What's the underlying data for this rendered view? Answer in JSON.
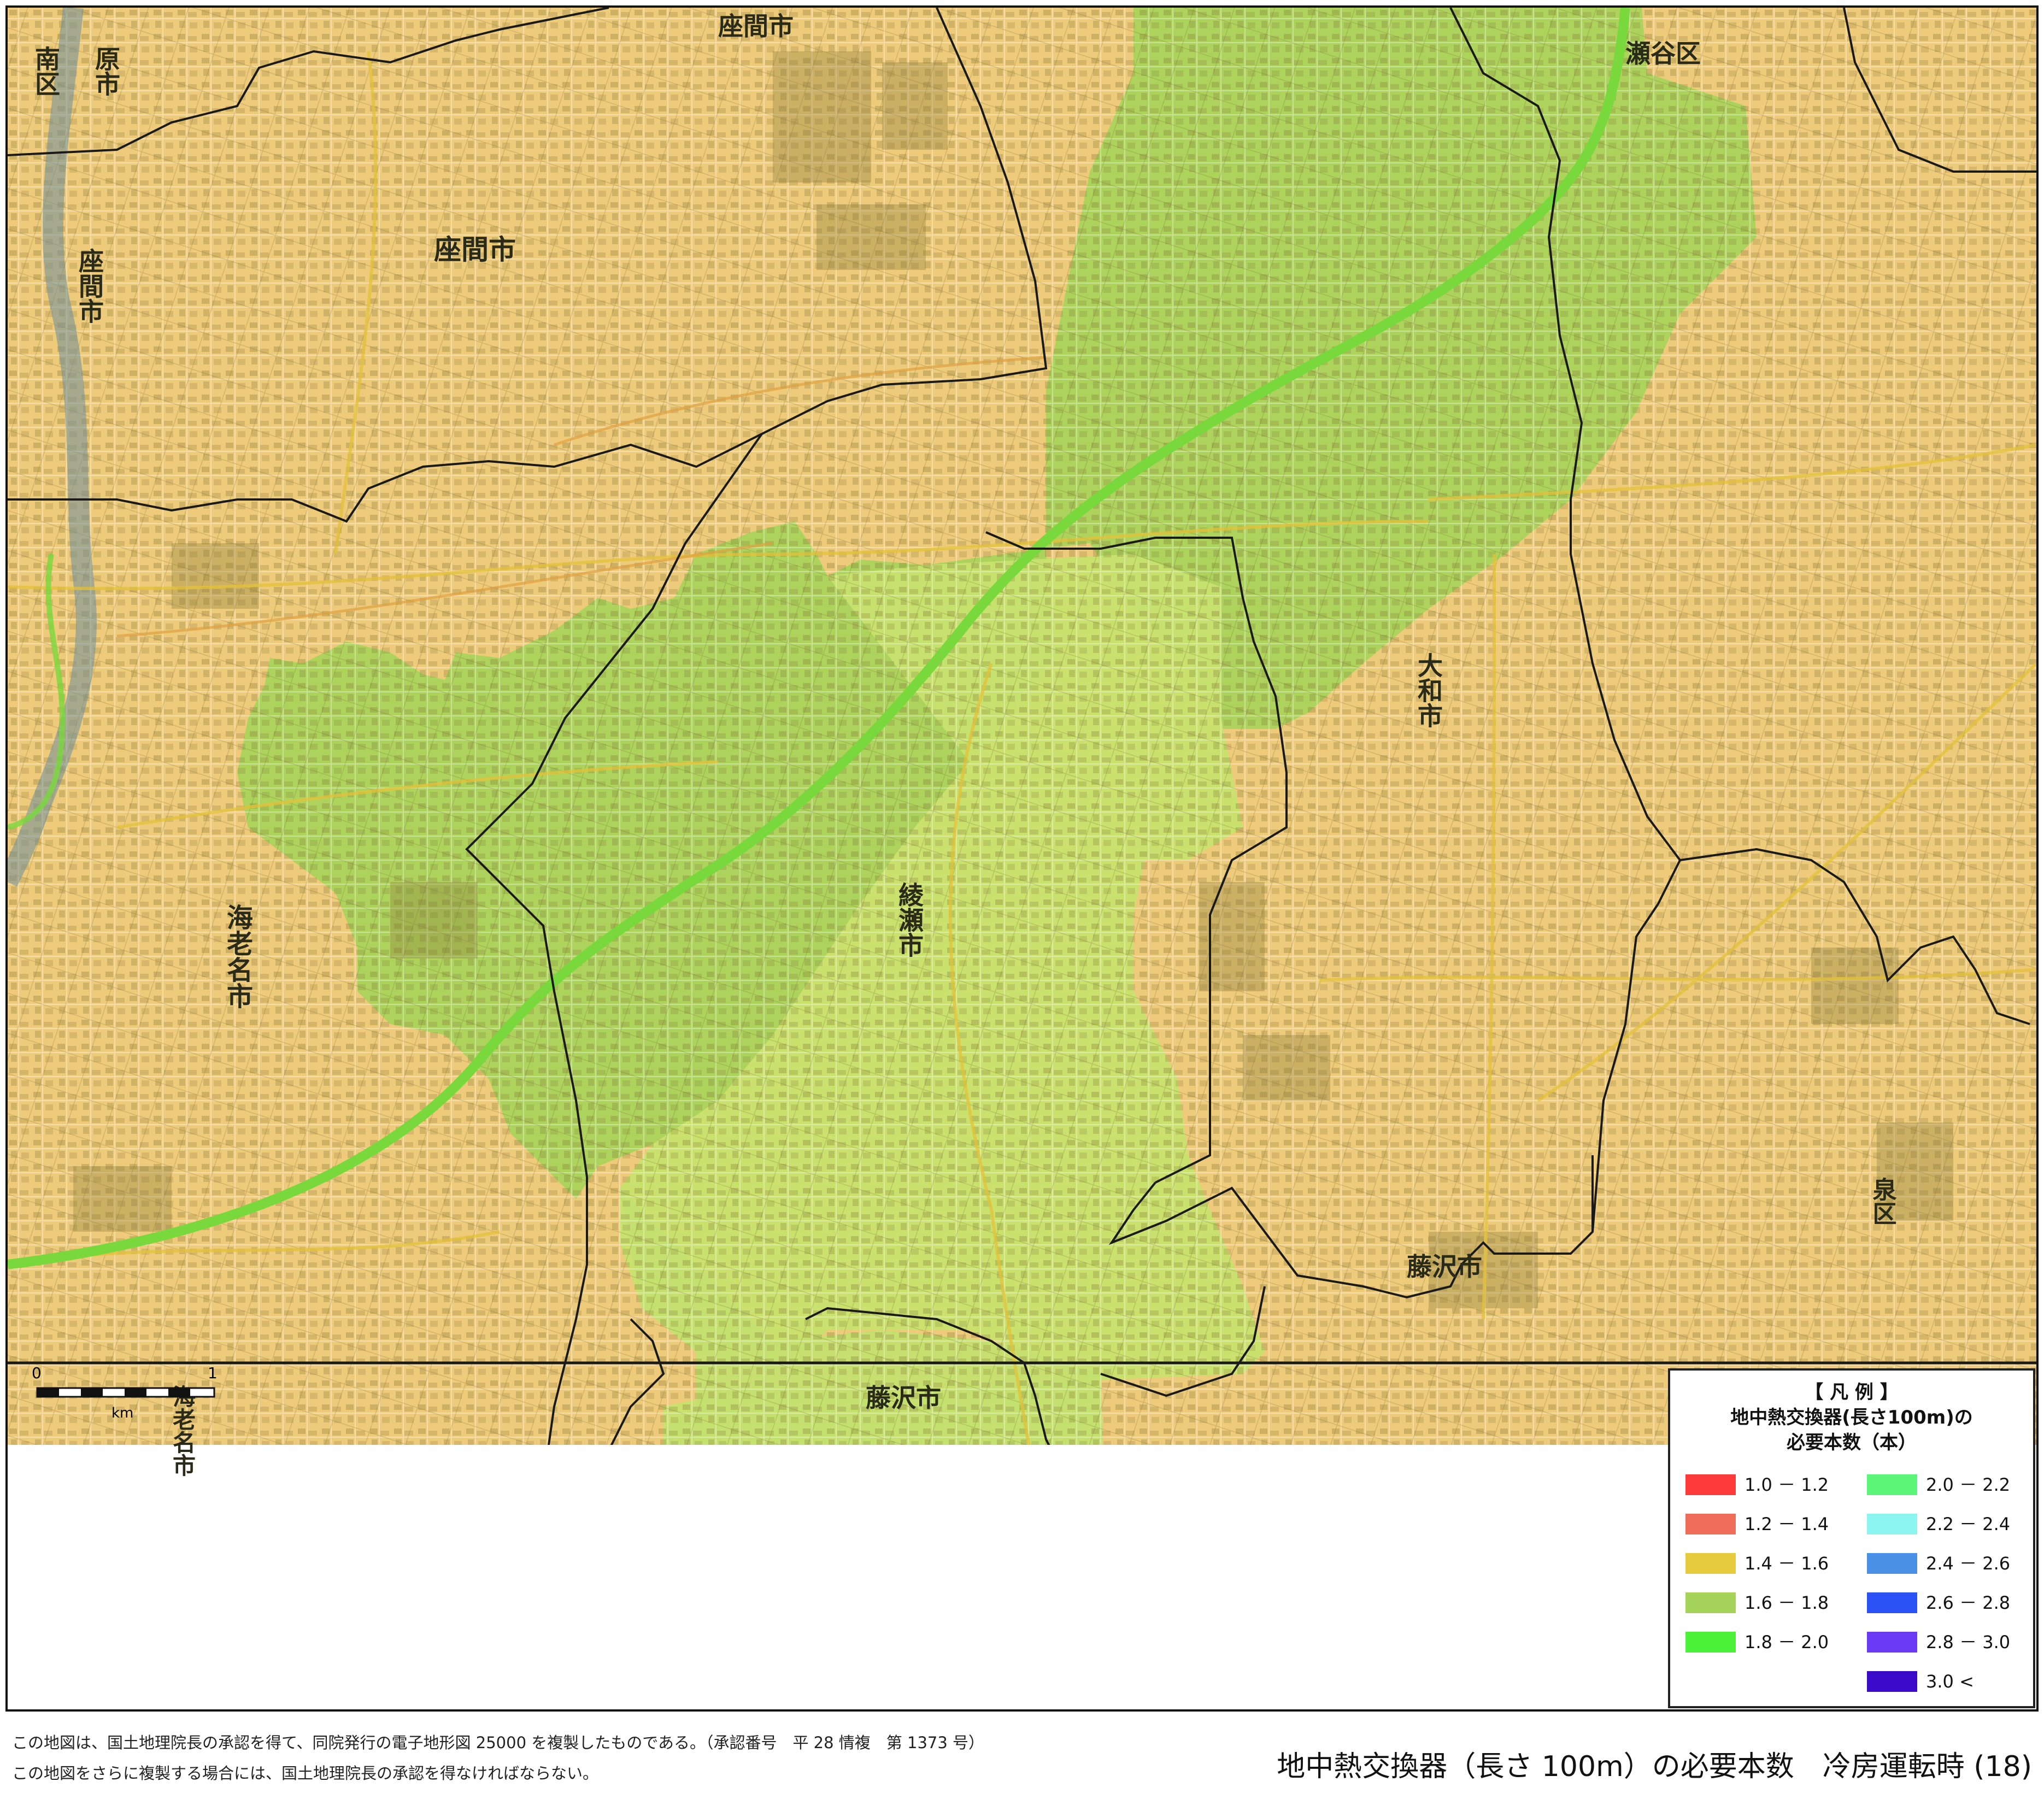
{
  "map": {
    "labels": [
      {
        "id": "minami-ku",
        "text": "南区"
      },
      {
        "id": "hara-shi",
        "text": "原市"
      },
      {
        "id": "zama-top",
        "text": "座間市"
      },
      {
        "id": "zama-center",
        "text": "座間市"
      },
      {
        "id": "zama-vertical",
        "text": "座間市"
      },
      {
        "id": "seya-ku",
        "text": "瀬谷区"
      },
      {
        "id": "ebina-shi",
        "text": "海老名市"
      },
      {
        "id": "ayase-shi",
        "text": "綾瀬市"
      },
      {
        "id": "yamato-shi",
        "text": "大和市"
      },
      {
        "id": "fujisawa-right",
        "text": "藤沢市"
      },
      {
        "id": "fujisawa-bottom",
        "text": "藤沢市"
      },
      {
        "id": "ebina-bottom",
        "text": "海老名市"
      },
      {
        "id": "izumi-ku",
        "text": "泉区"
      }
    ],
    "fill_colors": {
      "base": "#eecb7a",
      "class_1_4_1_6": "#e9cc7c",
      "class_1_6_1_8": "#c3df6e",
      "class_1_8_2_0": "#9fd85a",
      "road_major": "#78d83c",
      "boundary": "#1a1a1a"
    }
  },
  "scale": {
    "start": "0",
    "end": "1",
    "unit": "km"
  },
  "legend": {
    "title": "【 凡 例 】",
    "subtitle1": "地中熱交換器(長さ100m)の",
    "subtitle2": "必要本数（本）",
    "items": [
      {
        "label": "1.0 － 1.2",
        "color": "#ff3a3a"
      },
      {
        "label": "1.2 － 1.4",
        "color": "#ef6e5a"
      },
      {
        "label": "1.4 － 1.6",
        "color": "#e6cc3c"
      },
      {
        "label": "1.6 － 1.8",
        "color": "#a6d45a"
      },
      {
        "label": "1.8 － 2.0",
        "color": "#4cf23a"
      },
      {
        "label": "2.0 － 2.2",
        "color": "#5bf57a"
      },
      {
        "label": "2.2 － 2.4",
        "color": "#8cf5f0"
      },
      {
        "label": "2.4 － 2.6",
        "color": "#4a90e6"
      },
      {
        "label": "2.6 － 2.8",
        "color": "#2a52f5"
      },
      {
        "label": "2.8 － 3.0",
        "color": "#6a3af5"
      },
      {
        "label": "3.0 <",
        "color": "#3a0ac8"
      }
    ]
  },
  "footer": {
    "note1": "この地図は、国土地理院長の承認を得て、同院発行の電子地形図 25000 を複製したものである。（承認番号　平 28 情複　第 1373 号）",
    "note2": "この地図をさらに複製する場合には、国土地理院長の承認を得なければならない。",
    "title": "地中熱交換器（長さ 100m）の必要本数　冷房運転時 (18)"
  }
}
